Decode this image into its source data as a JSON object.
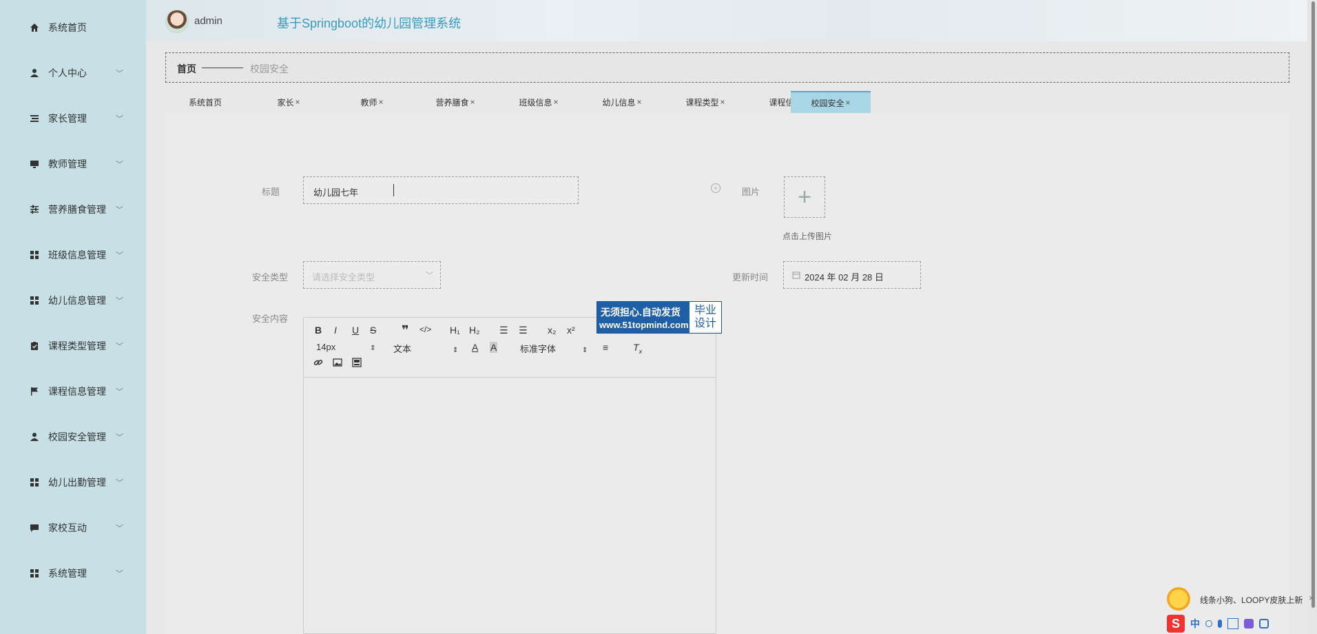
{
  "header": {
    "username": "admin",
    "system_title": "基于Springboot的幼儿园管理系统"
  },
  "sidebar": {
    "items": [
      {
        "label": "系统首页",
        "icon": "home-icon",
        "has_chevron": false
      },
      {
        "label": "个人中心",
        "icon": "user-icon",
        "has_chevron": true
      },
      {
        "label": "家长管理",
        "icon": "list-icon",
        "has_chevron": true
      },
      {
        "label": "教师管理",
        "icon": "monitor-icon",
        "has_chevron": true
      },
      {
        "label": "营养膳食管理",
        "icon": "sliders-icon",
        "has_chevron": true
      },
      {
        "label": "班级信息管理",
        "icon": "grid-icon",
        "has_chevron": true
      },
      {
        "label": "幼儿信息管理",
        "icon": "grid-icon",
        "has_chevron": true
      },
      {
        "label": "课程类型管理",
        "icon": "clipboard-icon",
        "has_chevron": true
      },
      {
        "label": "课程信息管理",
        "icon": "flag-icon",
        "has_chevron": true
      },
      {
        "label": "校园安全管理",
        "icon": "user-icon",
        "has_chevron": true
      },
      {
        "label": "幼儿出勤管理",
        "icon": "grid-icon",
        "has_chevron": true
      },
      {
        "label": "家校互动",
        "icon": "chat-icon",
        "has_chevron": true
      },
      {
        "label": "系统管理",
        "icon": "grid-icon",
        "has_chevron": true
      }
    ]
  },
  "breadcrumb": {
    "home": "首页",
    "current": "校园安全"
  },
  "tabs": [
    {
      "label": "系统首页",
      "closable": false,
      "active": false
    },
    {
      "label": "家长",
      "closable": true,
      "active": false
    },
    {
      "label": "教师",
      "closable": true,
      "active": false
    },
    {
      "label": "营养膳食",
      "closable": true,
      "active": false
    },
    {
      "label": "班级信息",
      "closable": true,
      "active": false
    },
    {
      "label": "幼儿信息",
      "closable": true,
      "active": false
    },
    {
      "label": "课程类型",
      "closable": true,
      "active": false
    },
    {
      "label": "课程信息",
      "closable": true,
      "active": false
    },
    {
      "label": "校园安全",
      "closable": true,
      "active": true
    }
  ],
  "form": {
    "title_label": "标题",
    "title_value": "幼儿园七年",
    "image_label": "图片",
    "upload_tip": "点击上传图片",
    "type_label": "安全类型",
    "type_placeholder": "请选择安全类型",
    "time_label": "更新时间",
    "time_value": "2024 年 02 月 28 日",
    "content_label": "安全内容"
  },
  "editor": {
    "font_size": "14px",
    "paragraph": "文本",
    "font_family": "标准字体"
  },
  "ad": {
    "line1": "无须担心.自动发货",
    "line2": "www.51topmind.com",
    "right_top": "毕业",
    "right_bottom": "设计"
  },
  "ime": {
    "notice": "线条小狗、LOOPY皮肤上新",
    "lang": "中"
  },
  "colors": {
    "sidebar_bg": "#c6e0e6",
    "title_color": "#3a9bc0",
    "active_tab": "#a9d6e4",
    "ad_bg": "#1f5fa8"
  }
}
